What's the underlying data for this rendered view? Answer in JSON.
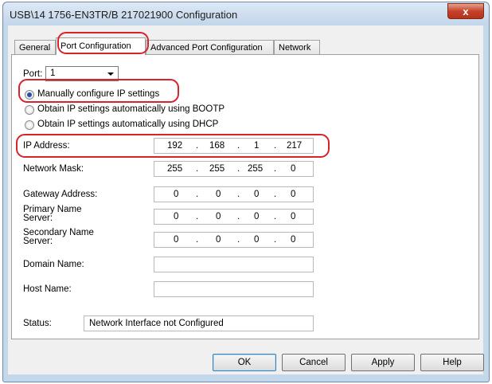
{
  "window": {
    "title": "USB\\14 1756-EN3TR/B 217021900 Configuration",
    "close_label": "x"
  },
  "tabs": [
    {
      "label": "General"
    },
    {
      "label": "Port Configuration",
      "active": true
    },
    {
      "label": "Advanced Port Configuration"
    },
    {
      "label": "Network"
    }
  ],
  "port": {
    "label": "Port:",
    "value": "1"
  },
  "ip_mode": [
    {
      "label": "Manually configure IP settings",
      "selected": true
    },
    {
      "label": "Obtain IP settings automatically using BOOTP",
      "selected": false
    },
    {
      "label": "Obtain IP settings automatically using DHCP",
      "selected": false
    }
  ],
  "fields": {
    "ip_address": {
      "label": "IP Address:",
      "octets": [
        "192",
        "168",
        "1",
        "217"
      ]
    },
    "network_mask": {
      "label": "Network Mask:",
      "octets": [
        "255",
        "255",
        "255",
        "0"
      ]
    },
    "gateway": {
      "label": "Gateway Address:",
      "octets": [
        "0",
        "0",
        "0",
        "0"
      ]
    },
    "primary_dns": {
      "label_line1": "Primary Name",
      "label_line2": "Server:",
      "octets": [
        "0",
        "0",
        "0",
        "0"
      ]
    },
    "secondary_dns": {
      "label_line1": "Secondary Name",
      "label_line2": "Server:",
      "octets": [
        "0",
        "0",
        "0",
        "0"
      ]
    },
    "domain_name": {
      "label": "Domain Name:",
      "value": ""
    },
    "host_name": {
      "label": "Host Name:",
      "value": ""
    }
  },
  "octet_separator": ".",
  "status": {
    "label": "Status:",
    "value": "Network Interface not Configured"
  },
  "buttons": {
    "ok": "OK",
    "cancel": "Cancel",
    "apply": "Apply",
    "help": "Help"
  },
  "colors": {
    "highlight": "#d8232a",
    "radio_selected": "#2450a8"
  }
}
